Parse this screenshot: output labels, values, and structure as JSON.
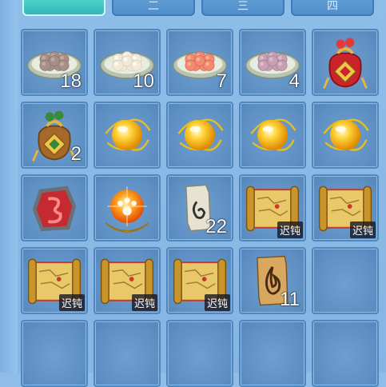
{
  "tabs": [
    {
      "label": "",
      "active": true
    },
    {
      "label": "二",
      "active": false
    },
    {
      "label": "三",
      "active": false
    },
    {
      "label": "四",
      "active": false
    }
  ],
  "tag_label": "迟钝",
  "slots": [
    {
      "item": "dumpling-plate-brown",
      "count": "18"
    },
    {
      "item": "dumpling-plate-white",
      "count": "10"
    },
    {
      "item": "dumpling-plate-pink",
      "count": "7"
    },
    {
      "item": "dumpling-plate-purple",
      "count": "4"
    },
    {
      "item": "lucky-bag-red",
      "count": ""
    },
    {
      "item": "lucky-bag-brown",
      "count": "2"
    },
    {
      "item": "gold-orb",
      "count": ""
    },
    {
      "item": "gold-orb",
      "count": ""
    },
    {
      "item": "gold-orb",
      "count": ""
    },
    {
      "item": "gold-orb",
      "count": ""
    },
    {
      "item": "red-rune-stone",
      "count": ""
    },
    {
      "item": "paw-orb",
      "count": ""
    },
    {
      "item": "small-scroll",
      "count": "22"
    },
    {
      "item": "treasure-map",
      "count": "",
      "tag": true
    },
    {
      "item": "treasure-map",
      "count": "",
      "tag": true
    },
    {
      "item": "treasure-map",
      "count": "",
      "tag": true
    },
    {
      "item": "treasure-map",
      "count": "",
      "tag": true
    },
    {
      "item": "treasure-map",
      "count": "",
      "tag": true
    },
    {
      "item": "flame-scroll",
      "count": "11"
    },
    {
      "item": "empty",
      "count": ""
    },
    {
      "item": "empty",
      "count": ""
    },
    {
      "item": "empty",
      "count": ""
    },
    {
      "item": "empty",
      "count": ""
    },
    {
      "item": "empty",
      "count": ""
    },
    {
      "item": "empty",
      "count": ""
    }
  ]
}
